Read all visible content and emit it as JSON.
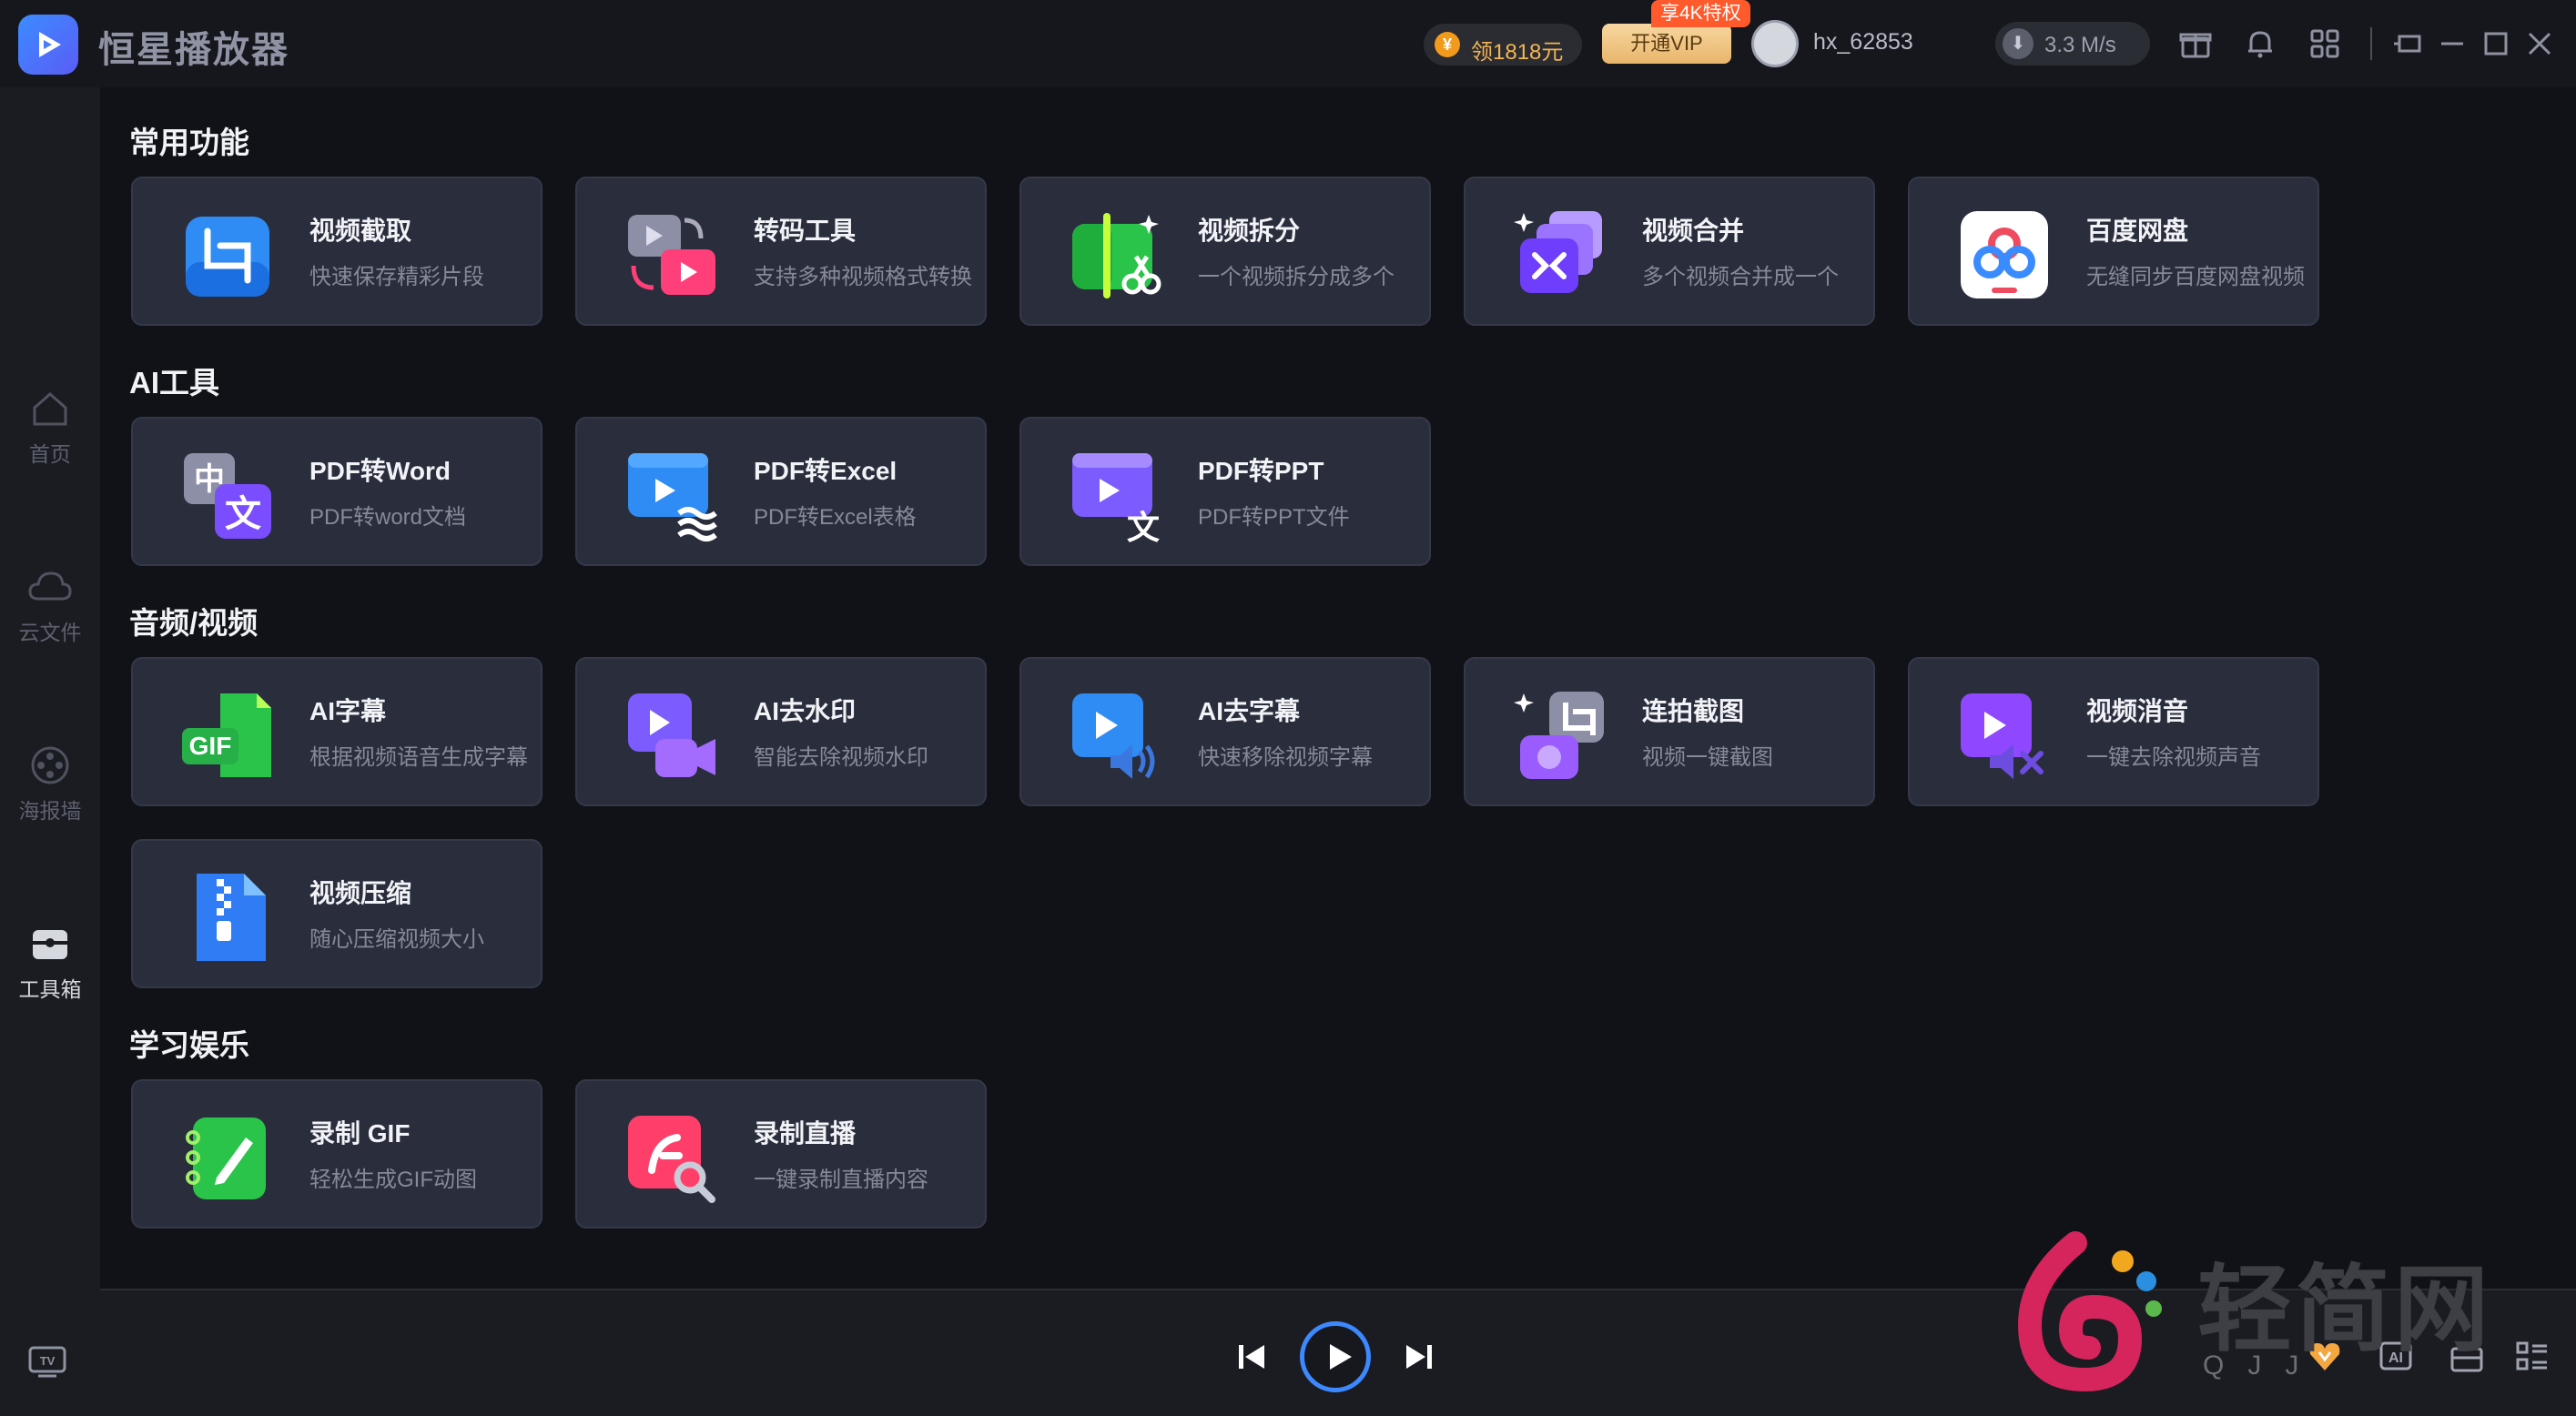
{
  "app": {
    "title": "恒星播放器"
  },
  "titlebar": {
    "coin": {
      "icon": "yen-coin-icon",
      "label": "领1818元"
    },
    "vip": {
      "badge": "享4K特权",
      "button": "开通VIP"
    },
    "user": {
      "name": "hx_62853"
    },
    "speed": {
      "icon": "download-icon",
      "label": "3.3 M/s"
    },
    "icons": [
      "gift-icon",
      "bell-icon",
      "grid-icon",
      "pin-window-icon",
      "minimize-icon",
      "maximize-icon",
      "close-icon"
    ]
  },
  "sidebar": {
    "items": [
      {
        "label": "首页",
        "icon": "home-icon"
      },
      {
        "label": "云文件",
        "icon": "cloud-icon"
      },
      {
        "label": "海报墙",
        "icon": "film-reel-icon"
      },
      {
        "label": "工具箱",
        "icon": "toolbox-icon"
      }
    ],
    "active": "工具箱",
    "bottom_icon": "tv-icon"
  },
  "sections": [
    {
      "title": "常用功能",
      "cards": [
        {
          "title": "视频截取",
          "desc": "快速保存精彩片段",
          "icon": "crop-icon"
        },
        {
          "title": "转码工具",
          "desc": "支持多种视频格式转换",
          "icon": "transcode-icon"
        },
        {
          "title": "视频拆分",
          "desc": "一个视频拆分成多个",
          "icon": "split-scissors-icon"
        },
        {
          "title": "视频合并",
          "desc": "多个视频合并成一个",
          "icon": "merge-icon"
        },
        {
          "title": "百度网盘",
          "desc": "无缝同步百度网盘视频",
          "icon": "baidu-netdisk-icon"
        }
      ]
    },
    {
      "title": "AI工具",
      "cards": [
        {
          "title": "PDF转Word",
          "desc": "PDF转word文档",
          "icon": "translate-doc-icon"
        },
        {
          "title": "PDF转Excel",
          "desc": "PDF转Excel表格",
          "icon": "video-wave-icon"
        },
        {
          "title": "PDF转PPT",
          "desc": "PDF转PPT文件",
          "icon": "video-translate-icon"
        }
      ]
    },
    {
      "title": "音频/视频",
      "cards": [
        {
          "title": "AI字幕",
          "desc": "根据视频语音生成字幕",
          "icon": "gif-subtitle-icon"
        },
        {
          "title": "AI去水印",
          "desc": "智能去除视频水印",
          "icon": "camera-video-icon"
        },
        {
          "title": "AI去字幕",
          "desc": "快速移除视频字幕",
          "icon": "video-sound-icon"
        },
        {
          "title": "连拍截图",
          "desc": "视频一键截图",
          "icon": "burst-screenshot-icon"
        },
        {
          "title": "视频消音",
          "desc": "一键去除视频声音",
          "icon": "mute-video-icon"
        },
        {
          "title": "视频压缩",
          "desc": "随心压缩视频大小",
          "icon": "zip-file-icon"
        }
      ]
    },
    {
      "title": "学习娱乐",
      "cards": [
        {
          "title": "录制 GIF",
          "desc": "轻松生成GIF动图",
          "icon": "notebook-pen-icon"
        },
        {
          "title": "录制直播",
          "desc": "一键录制直播内容",
          "icon": "flash-search-icon"
        }
      ]
    }
  ],
  "player": {
    "controls": [
      "previous-icon",
      "play-icon",
      "next-icon"
    ]
  },
  "bottom_right_icons": [
    "heart-badge-icon",
    "ai-icon",
    "briefcase-icon",
    "list-icon"
  ],
  "watermark": {
    "text": "轻简网",
    "sub": "QJJ"
  }
}
